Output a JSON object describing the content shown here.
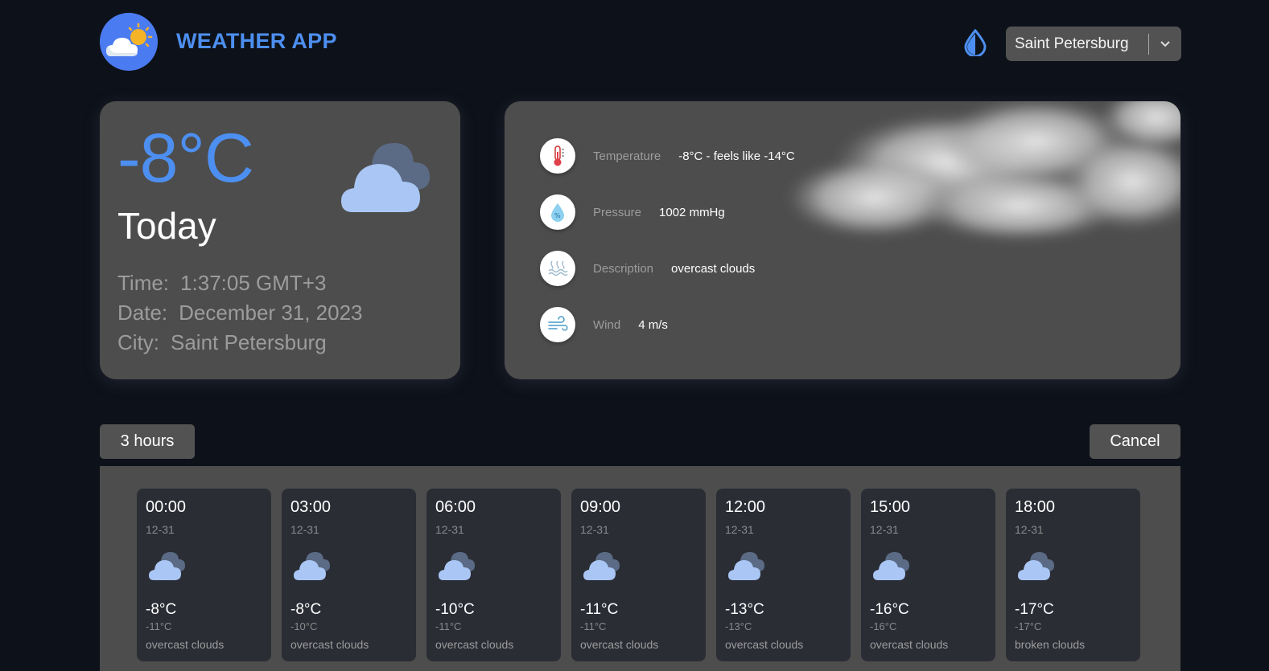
{
  "header": {
    "app_title": "WEATHER APP",
    "logo_icon": "sun-cloud-logo-icon",
    "theme_icon": "droplet-icon",
    "city_select": {
      "value": "Saint Petersburg",
      "icon": "chevron-down-icon"
    }
  },
  "today": {
    "temperature": "-8°C",
    "label": "Today",
    "icon": "cloud-icon",
    "time_label": "Time:",
    "time_value": "1:37:05 GMT+3",
    "date_label": "Date:",
    "date_value": "December 31, 2023",
    "city_label": "City:",
    "city_value": "Saint Petersburg"
  },
  "details": [
    {
      "icon": "thermometer-icon",
      "label": "Temperature",
      "value": "-8°C - feels like -14°C"
    },
    {
      "icon": "pressure-icon",
      "label": "Pressure",
      "value": "1002 mmHg"
    },
    {
      "icon": "water-waves-icon",
      "label": "Description",
      "value": "overcast clouds"
    },
    {
      "icon": "wind-icon",
      "label": "Wind",
      "value": "4 m/s"
    }
  ],
  "forecast": {
    "hours_button": "3 hours",
    "cancel_button": "Cancel",
    "items": [
      {
        "time": "00:00",
        "date": "12-31",
        "temp": "-8°C",
        "feels": "-11°C",
        "desc": "overcast clouds"
      },
      {
        "time": "03:00",
        "date": "12-31",
        "temp": "-8°C",
        "feels": "-10°C",
        "desc": "overcast clouds"
      },
      {
        "time": "06:00",
        "date": "12-31",
        "temp": "-10°C",
        "feels": "-11°C",
        "desc": "overcast clouds"
      },
      {
        "time": "09:00",
        "date": "12-31",
        "temp": "-11°C",
        "feels": "-11°C",
        "desc": "overcast clouds"
      },
      {
        "time": "12:00",
        "date": "12-31",
        "temp": "-13°C",
        "feels": "-13°C",
        "desc": "overcast clouds"
      },
      {
        "time": "15:00",
        "date": "12-31",
        "temp": "-16°C",
        "feels": "-16°C",
        "desc": "overcast clouds"
      },
      {
        "time": "18:00",
        "date": "12-31",
        "temp": "-17°C",
        "feels": "-17°C",
        "desc": "broken clouds"
      }
    ]
  },
  "colors": {
    "accent": "#4d8ff0",
    "background": "#0d1119",
    "card": "#4d4d4d",
    "forecast_card": "#2b2d35"
  }
}
